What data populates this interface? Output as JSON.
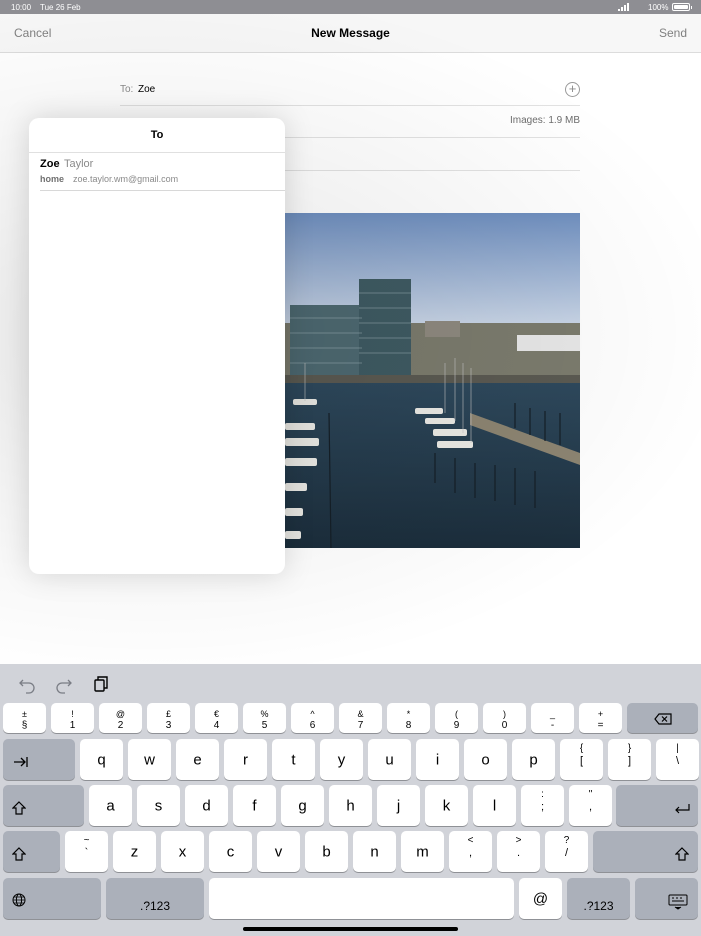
{
  "status_bar": {
    "time": "10:00",
    "date": "Tue 26 Feb",
    "battery": "100%"
  },
  "navbar": {
    "cancel": "Cancel",
    "title": "New Message",
    "send": "Send"
  },
  "compose": {
    "to_label": "To:",
    "to_value": "Zoe",
    "images_size": "Images: 1.9 MB"
  },
  "popover": {
    "title": "To",
    "suggestions": [
      {
        "first": "Zoe",
        "last": "Taylor",
        "type": "home",
        "email": "zoe.taylor.wm@gmail.com"
      }
    ]
  },
  "keyboard": {
    "toolbar": [
      "undo-icon",
      "redo-icon",
      "paste-icon"
    ],
    "number_row": [
      {
        "top": "±",
        "bottom": "§"
      },
      {
        "top": "!",
        "bottom": "1"
      },
      {
        "top": "@",
        "bottom": "2"
      },
      {
        "top": "£",
        "bottom": "3"
      },
      {
        "top": "€",
        "bottom": "4"
      },
      {
        "top": "%",
        "bottom": "5"
      },
      {
        "top": "^",
        "bottom": "6"
      },
      {
        "top": "&",
        "bottom": "7"
      },
      {
        "top": "*",
        "bottom": "8"
      },
      {
        "top": "(",
        "bottom": "9"
      },
      {
        "top": ")",
        "bottom": "0"
      },
      {
        "top": "_",
        "bottom": "-"
      },
      {
        "top": "+",
        "bottom": "="
      }
    ],
    "row_q": [
      "q",
      "w",
      "e",
      "r",
      "t",
      "y",
      "u",
      "i",
      "o",
      "p"
    ],
    "row_q_extra": [
      {
        "top": "{",
        "bottom": "["
      },
      {
        "top": "}",
        "bottom": "]"
      },
      {
        "top": "|",
        "bottom": "\\"
      }
    ],
    "row_a": [
      "a",
      "s",
      "d",
      "f",
      "g",
      "h",
      "j",
      "k",
      "l"
    ],
    "row_a_extra": [
      {
        "top": ":",
        "bottom": ";"
      },
      {
        "top": "\"",
        "bottom": ","
      }
    ],
    "row_z": [
      "z",
      "x",
      "c",
      "v",
      "b",
      "n",
      "m"
    ],
    "row_z_first": {
      "top": "~",
      "bottom": "`"
    },
    "row_z_extra": [
      {
        "top": "<",
        "bottom": ","
      },
      {
        "top": ">",
        "bottom": "."
      },
      {
        "top": "?",
        "bottom": "/"
      }
    ],
    "mode_label": ".?123",
    "at_label": "@"
  }
}
